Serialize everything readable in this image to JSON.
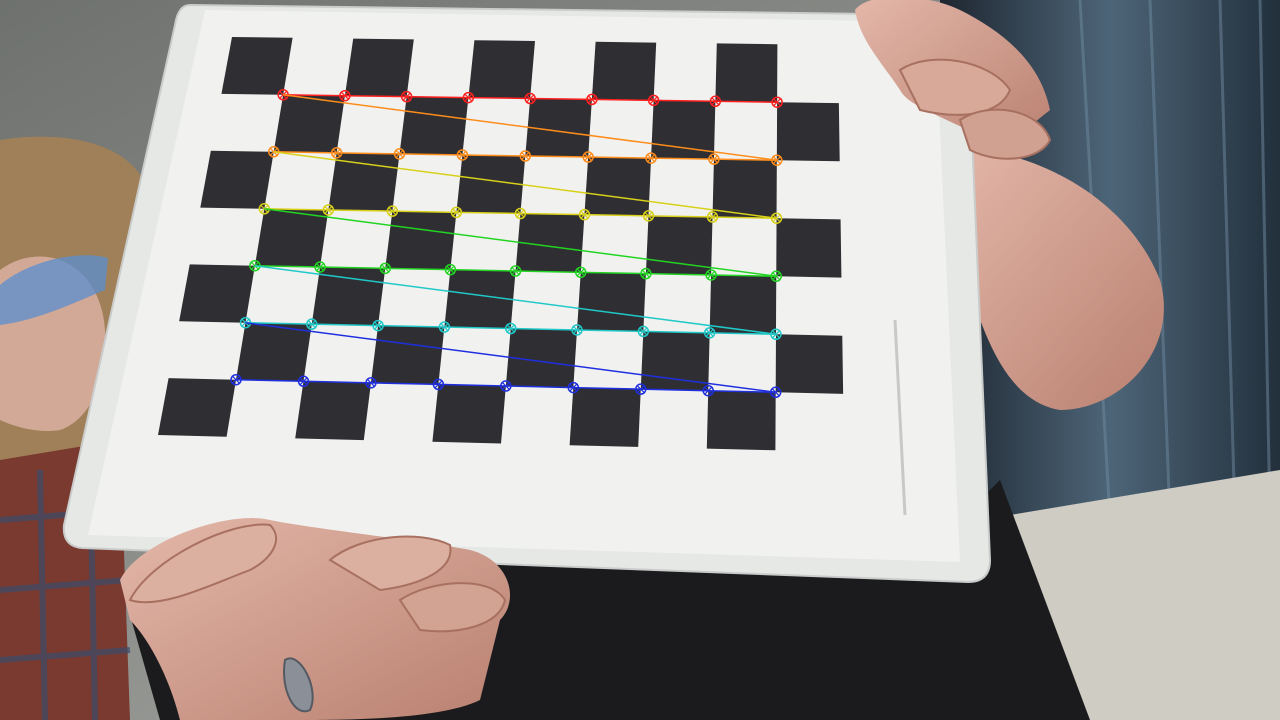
{
  "scene": {
    "description_tags": [
      "checkerboard-calibration-target",
      "held-by-hands",
      "detected-corners-overlay"
    ],
    "board": {
      "squares_cols": 10,
      "squares_rows": 7,
      "inner_corners_cols": 9,
      "inner_corners_rows": 6,
      "dark_square_color": "#2f2f33",
      "paper_color": "#f1f2f0",
      "backing_color": "#e6e8e6"
    },
    "overlay": {
      "row_colors": [
        "#ff2020",
        "#ff8c1a",
        "#d8d018",
        "#22d422",
        "#20c8c8",
        "#1f2fe0"
      ],
      "marker": "circle-with-cross"
    },
    "background": {
      "left_wall_color": "#8b8e8a",
      "right_curtain_color": "#2c3c4c",
      "floor_color": "#cfccc4",
      "shirt_color": "#1b1b1d",
      "skin_color": "#d8a898"
    }
  }
}
